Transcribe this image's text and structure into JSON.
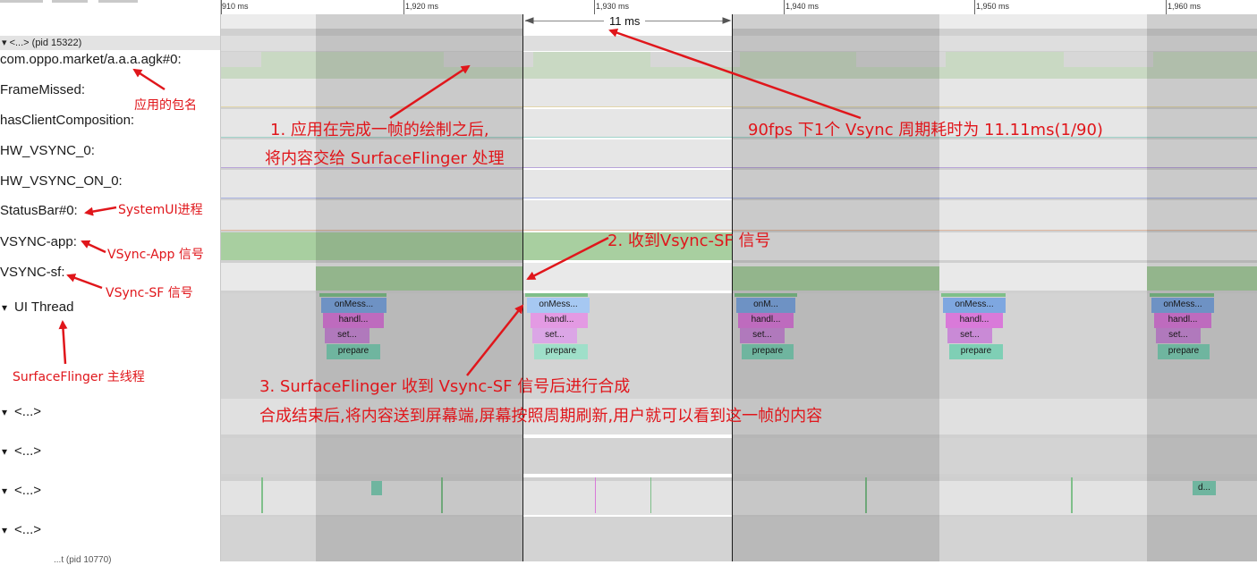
{
  "ruler": {
    "ticks": [
      "910 ms",
      "1,920 ms",
      "1,930 ms",
      "1,940 ms",
      "1,950 ms",
      "1,960 ms"
    ],
    "selection_label": "11 ms"
  },
  "process_header": "▾ <...> (pid 15322)",
  "tracks": {
    "market": "com.oppo.market/a.a.a.agk#0:",
    "frame_missed": "FrameMissed:",
    "client_comp": "hasClientComposition:",
    "hw_vsync": "HW_VSYNC_0:",
    "hw_vsync_on": "HW_VSYNC_ON_0:",
    "statusbar": "StatusBar#0:",
    "vsync_app": "VSYNC-app:",
    "vsync_sf": "VSYNC-sf:",
    "ui_thread": "UI Thread",
    "thread_a": "<...>",
    "thread_b": "<...>",
    "thread_c": "<...>",
    "thread_d": "<...>",
    "collapsed_glyph": "▾",
    "partial_footer": "...t (pid 10770)"
  },
  "slices": {
    "group1": [
      "onMess...",
      "handl...",
      "set...",
      "prepare"
    ],
    "group2": [
      "onMess...",
      "handl...",
      "set...",
      "prepare"
    ],
    "group3": [
      "onM...",
      "handl...",
      "set...",
      "prepare"
    ],
    "group4": [
      "onMess...",
      "handl...",
      "set...",
      "prepare"
    ],
    "group5": [
      "onMess...",
      "handl...",
      "set...",
      "prepare"
    ],
    "d_slice": "d..."
  },
  "annotations": {
    "pkg_name": "应用的包名",
    "step1_line1": "1. 应用在完成一帧的绘制之后,",
    "step1_line2": "将内容交给 SurfaceFlinger 处理",
    "fps_note": "90fps 下1个 Vsync 周期耗时为 11.11ms(1/90)",
    "systemui": "SystemUI进程",
    "step2": "2. 收到Vsync-SF 信号",
    "vsync_app": "VSync-App 信号",
    "vsync_sf": "VSync-SF 信号",
    "sf_main": "SurfaceFlinger 主线程",
    "step3_line1": "3. SurfaceFlinger 收到 Vsync-SF 信号后进行合成",
    "step3_line2": "合成结束后,将内容送到屏幕端,屏幕按照周期刷新,用户就可以看到这一帧的内容"
  },
  "colors": {
    "annotation_red": "#e0161b",
    "slice_onmessage": "#7ea7e0",
    "slice_handle": "#d97ad9",
    "slice_set": "#c98ad6",
    "slice_prepare": "#7fcfb5",
    "vsync_green": "#a8cfa0"
  }
}
